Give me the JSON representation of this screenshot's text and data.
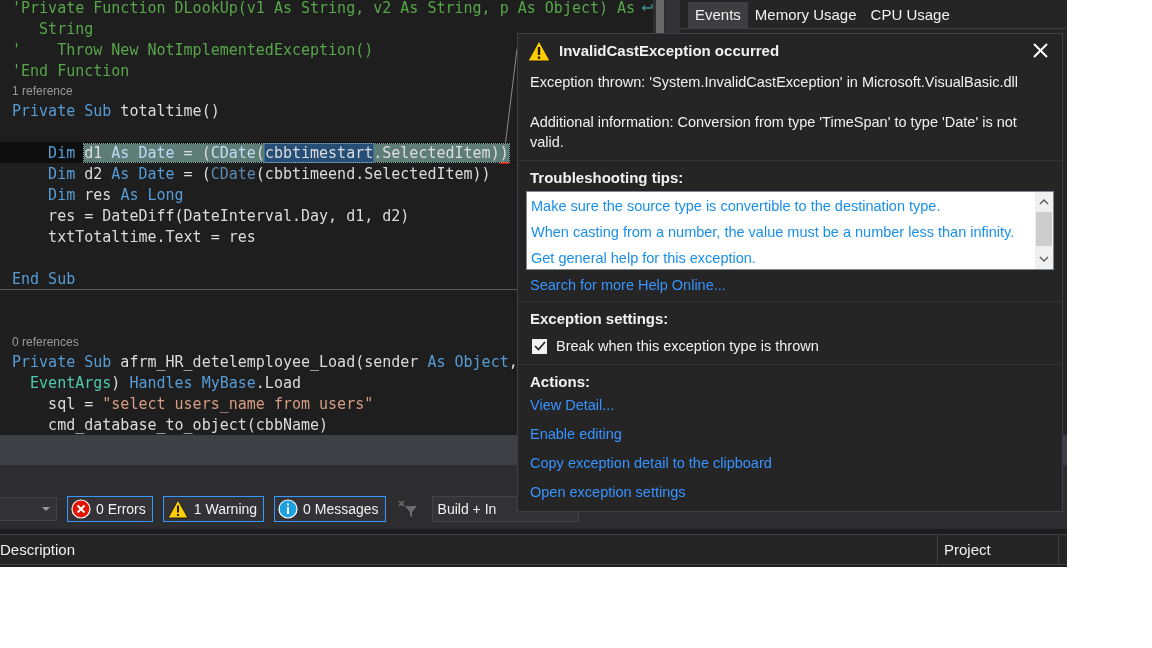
{
  "editor": {
    "blocks": [
      {
        "lines": [
          {
            "kind": "wrapped",
            "tokens": [
              {
                "text": "'Private Function DLookUp(v1 As String, v2 As String, p As Object) As",
                "kind": "comment"
              }
            ]
          },
          {
            "kind": "code",
            "tokens": [
              {
                "text": "   String",
                "kind": "comment"
              }
            ]
          },
          {
            "kind": "code",
            "tokens": [
              {
                "text": "'    Throw New NotImplementedException()",
                "kind": "comment"
              }
            ]
          },
          {
            "kind": "code",
            "tokens": [
              {
                "text": "'End Function",
                "kind": "comment"
              }
            ]
          },
          {
            "kind": "codelens",
            "text": "1 reference"
          },
          {
            "kind": "code",
            "tokens": [
              {
                "text": "Private Sub",
                "kind": "keyword"
              },
              {
                "text": " totaltime()",
                "kind": "plain"
              }
            ]
          },
          {
            "kind": "blank"
          },
          {
            "kind": "current",
            "tokens": [
              {
                "text": "    Dim ",
                "kind": "keyword"
              }
            ],
            "statement": [
              {
                "text": "d1 ",
                "kind": "plain"
              },
              {
                "text": "As Date",
                "kind": "keyword"
              },
              {
                "text": " = (",
                "kind": "plain"
              },
              {
                "text": "CDate",
                "kind": "function"
              },
              {
                "text": "(",
                "kind": "plain"
              },
              {
                "text": "cbbtimestart",
                "kind": "selected"
              },
              {
                "text": ".SelectedItem)",
                "kind": "plain"
              },
              {
                "text": ")",
                "kind": "error"
              }
            ]
          },
          {
            "kind": "code",
            "tokens": [
              {
                "text": "    Dim",
                "kind": "keyword"
              },
              {
                "text": " d2 ",
                "kind": "plain"
              },
              {
                "text": "As Date",
                "kind": "keyword"
              },
              {
                "text": " = (",
                "kind": "plain"
              },
              {
                "text": "CDate",
                "kind": "function"
              },
              {
                "text": "(cbbtimeend.SelectedItem))",
                "kind": "plain"
              }
            ]
          },
          {
            "kind": "code",
            "tokens": [
              {
                "text": "    Dim",
                "kind": "keyword"
              },
              {
                "text": " res ",
                "kind": "plain"
              },
              {
                "text": "As Long",
                "kind": "keyword"
              }
            ]
          },
          {
            "kind": "code",
            "tokens": [
              {
                "text": "    res = DateDiff(DateInterval.Day, d1, d2)",
                "kind": "plain"
              }
            ]
          },
          {
            "kind": "code",
            "tokens": [
              {
                "text": "    txtTotaltime.Text = res",
                "kind": "plain"
              }
            ]
          },
          {
            "kind": "blank"
          },
          {
            "kind": "code",
            "tokens": [
              {
                "text": "End Sub",
                "kind": "keyword"
              }
            ]
          }
        ]
      },
      {
        "lines": [
          {
            "kind": "blank"
          },
          {
            "kind": "blank"
          },
          {
            "kind": "codelens",
            "text": "0 references"
          },
          {
            "kind": "code",
            "tokens": [
              {
                "text": "Private Sub",
                "kind": "keyword"
              },
              {
                "text": " afrm_HR_detelemployee_Load(sender ",
                "kind": "plain"
              },
              {
                "text": "As Object",
                "kind": "keyword"
              },
              {
                "text": ",",
                "kind": "plain"
              }
            ]
          },
          {
            "kind": "code",
            "tokens": [
              {
                "text": "  EventArgs",
                "kind": "type"
              },
              {
                "text": ") ",
                "kind": "plain"
              },
              {
                "text": "Handles MyBase",
                "kind": "keyword"
              },
              {
                "text": ".Load",
                "kind": "plain"
              }
            ]
          },
          {
            "kind": "code",
            "tokens": [
              {
                "text": "    sql = ",
                "kind": "plain"
              },
              {
                "text": "\"select users_name from users\"",
                "kind": "string"
              }
            ]
          },
          {
            "kind": "code",
            "tokens": [
              {
                "text": "    cmd_database_to_object(cbbName)",
                "kind": "plain"
              }
            ]
          }
        ]
      }
    ]
  },
  "diagnostics_panel": {
    "tabs": [
      {
        "label": "Events",
        "selected": true
      },
      {
        "label": "Memory Usage",
        "selected": false
      },
      {
        "label": "CPU Usage",
        "selected": false
      }
    ]
  },
  "error_list": {
    "filters": [
      {
        "kind": "error",
        "label": "0 Errors",
        "selected": true
      },
      {
        "kind": "warning",
        "label": "1 Warning",
        "selected": true
      },
      {
        "kind": "info",
        "label": "0 Messages",
        "selected": true
      }
    ],
    "build_dropdown": "Build + In",
    "columns": [
      "Description",
      "Project"
    ]
  },
  "exception_popup": {
    "title": "InvalidCastException occurred",
    "message": "Exception thrown: 'System.InvalidCastException' in Microsoft.VisualBasic.dll",
    "additional_info": "Additional information: Conversion from type 'TimeSpan' to type 'Date' is not valid.",
    "tips_heading": "Troubleshooting tips:",
    "tips": [
      "Make sure the source type is convertible to the destination type.",
      "When casting from a number, the value must be a number less than infinity.",
      "Get general help for this exception."
    ],
    "search_link": "Search for more Help Online...",
    "settings_heading": "Exception settings:",
    "break_option": {
      "label": "Break when this exception type is thrown",
      "checked": true
    },
    "actions_heading": "Actions:",
    "actions": [
      "View Detail...",
      "Enable editing",
      "Copy exception detail to the clipboard",
      "Open exception settings"
    ]
  }
}
